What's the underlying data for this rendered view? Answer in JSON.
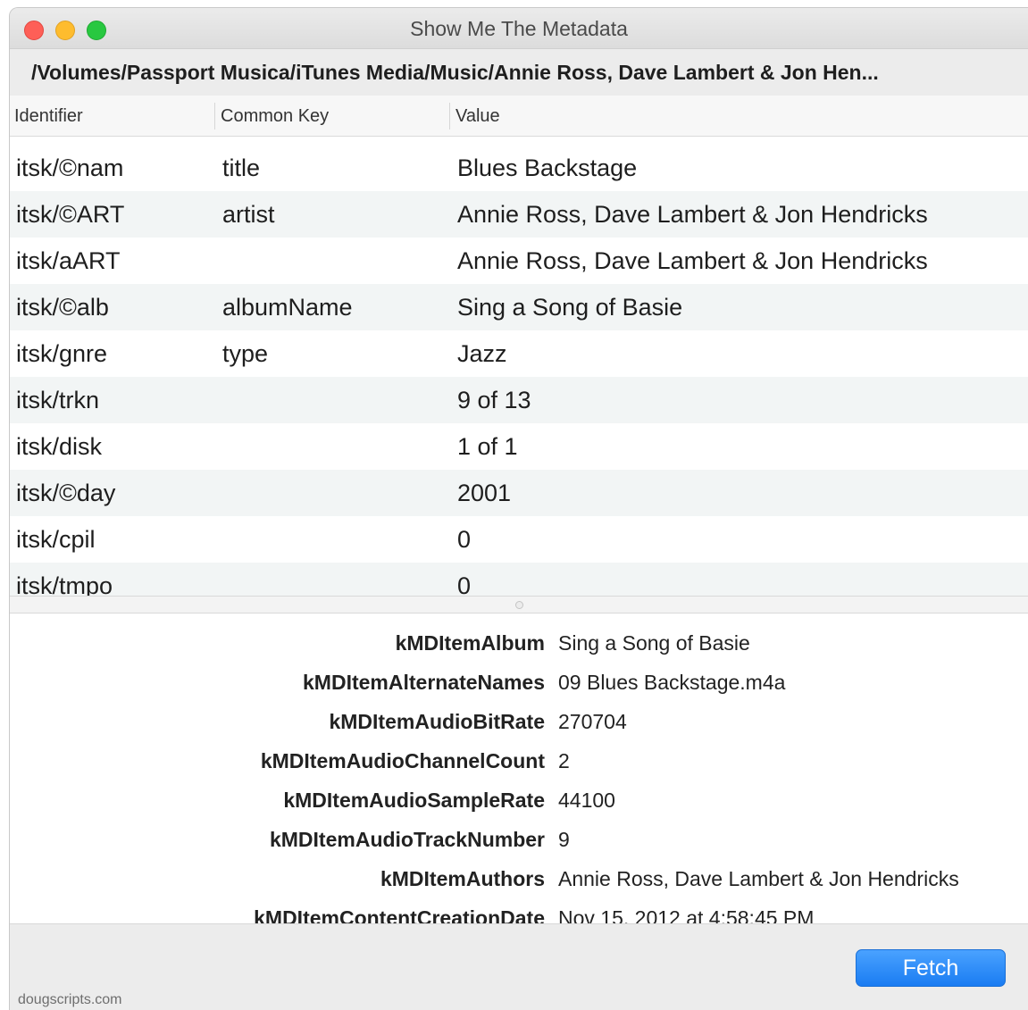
{
  "window": {
    "title": "Show Me The Metadata",
    "path": "/Volumes/Passport Musica/iTunes Media/Music/Annie Ross, Dave Lambert & Jon Hen..."
  },
  "table": {
    "columns": [
      "Identifier",
      "Common Key",
      "Value"
    ],
    "rows": [
      {
        "identifier": "itsk/©nam",
        "common_key": "title",
        "value": "Blues Backstage"
      },
      {
        "identifier": "itsk/©ART",
        "common_key": "artist",
        "value": "Annie Ross, Dave Lambert & Jon Hendricks"
      },
      {
        "identifier": "itsk/aART",
        "common_key": "",
        "value": "Annie Ross, Dave Lambert & Jon Hendricks"
      },
      {
        "identifier": "itsk/©alb",
        "common_key": "albumName",
        "value": "Sing a Song of Basie"
      },
      {
        "identifier": "itsk/gnre",
        "common_key": "type",
        "value": "Jazz"
      },
      {
        "identifier": "itsk/trkn",
        "common_key": "",
        "value": "9 of 13"
      },
      {
        "identifier": "itsk/disk",
        "common_key": "",
        "value": "1 of 1"
      },
      {
        "identifier": "itsk/©day",
        "common_key": "",
        "value": "2001"
      },
      {
        "identifier": "itsk/cpil",
        "common_key": "",
        "value": "0"
      },
      {
        "identifier": "itsk/tmpo",
        "common_key": "",
        "value": "0"
      }
    ]
  },
  "metadata": [
    {
      "key": "kMDItemAlbum",
      "value": "Sing a Song of Basie"
    },
    {
      "key": "kMDItemAlternateNames",
      "value": "09 Blues Backstage.m4a"
    },
    {
      "key": "kMDItemAudioBitRate",
      "value": "270704"
    },
    {
      "key": "kMDItemAudioChannelCount",
      "value": "2"
    },
    {
      "key": "kMDItemAudioSampleRate",
      "value": "44100"
    },
    {
      "key": "kMDItemAudioTrackNumber",
      "value": "9"
    },
    {
      "key": "kMDItemAuthors",
      "value": "Annie Ross, Dave Lambert & Jon Hendricks"
    },
    {
      "key": "kMDItemContentCreationDate",
      "value": "Nov 15, 2012 at 4:58:45 PM"
    }
  ],
  "buttons": {
    "fetch": "Fetch"
  },
  "footer": {
    "credit": "dougscripts.com"
  },
  "colors": {
    "close": "#fe5f57",
    "minimize": "#febc2e",
    "maximize": "#28c840",
    "accent": "#1a7cf2"
  }
}
